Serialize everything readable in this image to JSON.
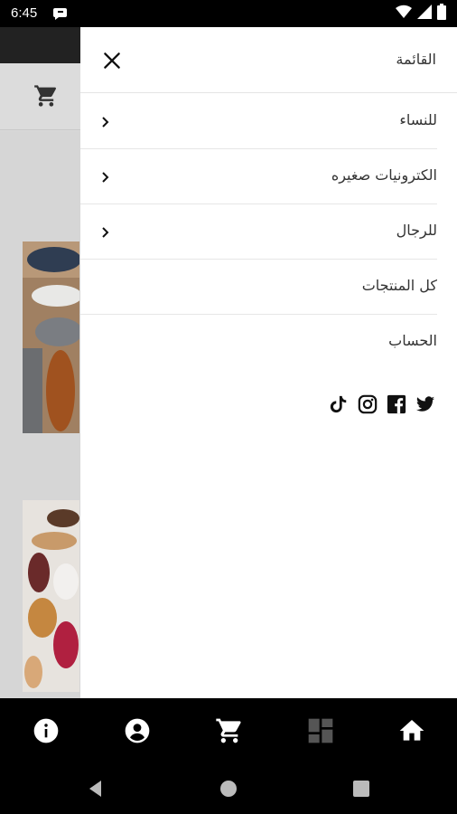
{
  "status_bar": {
    "time": "6:45"
  },
  "drawer": {
    "title": "القائمة",
    "items": [
      {
        "label": "للنساء",
        "has_submenu": true
      },
      {
        "label": "الكترونيات صغيره",
        "has_submenu": true
      },
      {
        "label": "للرجال",
        "has_submenu": true
      },
      {
        "label": "كل المنتجات",
        "has_submenu": false
      },
      {
        "label": "الحساب",
        "has_submenu": false
      }
    ],
    "social_icons": [
      "tiktok-icon",
      "instagram-icon",
      "facebook-icon",
      "twitter-icon"
    ]
  },
  "bottom_nav": {
    "icons": [
      "info-icon",
      "account-icon",
      "cart-icon",
      "dashboard-icon",
      "home-icon"
    ]
  },
  "system_nav": {
    "icons": [
      "back-icon",
      "home-circle-icon",
      "recents-icon"
    ]
  },
  "colors": {
    "drawer_bg": "#ffffff",
    "text": "#333333",
    "nav_bg": "#000000",
    "scrim": "#d9d9d9"
  }
}
